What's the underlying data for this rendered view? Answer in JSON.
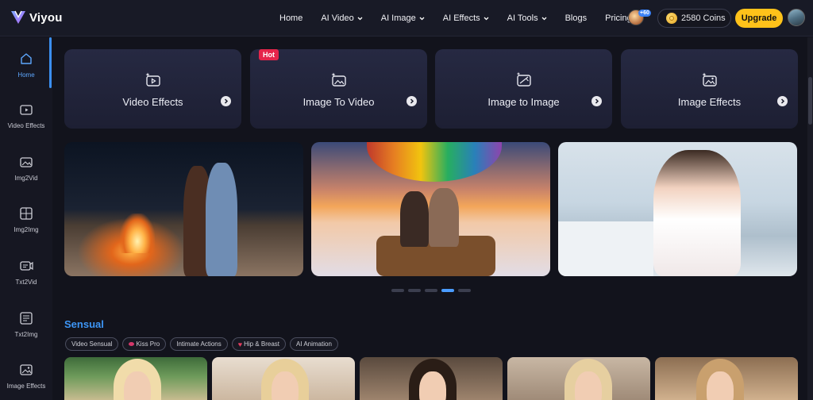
{
  "header": {
    "brand": "Viyou",
    "nav": [
      {
        "label": "Home",
        "dropdown": false
      },
      {
        "label": "AI Video",
        "dropdown": true
      },
      {
        "label": "AI Image",
        "dropdown": true
      },
      {
        "label": "AI Effects",
        "dropdown": true
      },
      {
        "label": "AI Tools",
        "dropdown": true
      },
      {
        "label": "Blogs",
        "dropdown": false
      },
      {
        "label": "Pricing",
        "dropdown": false
      }
    ],
    "bonus_badge": "+60",
    "coins": "2580 Coins",
    "upgrade_label": "Upgrade"
  },
  "sidebar": {
    "items": [
      {
        "label": "Home",
        "icon": "home-icon",
        "active": true
      },
      {
        "label": "Video Effects",
        "icon": "video-effects-icon",
        "active": false
      },
      {
        "label": "Img2Vid",
        "icon": "image-to-video-icon",
        "active": false
      },
      {
        "label": "Img2Img",
        "icon": "image-to-image-icon",
        "active": false
      },
      {
        "label": "Txt2Vid",
        "icon": "text-to-video-icon",
        "active": false
      },
      {
        "label": "Txt2Img",
        "icon": "text-to-image-icon",
        "active": false
      },
      {
        "label": "Image Effects",
        "icon": "image-effects-icon",
        "active": false
      }
    ]
  },
  "features": {
    "cards": [
      {
        "label": "Video Effects",
        "icon": "video-sparkle-icon"
      },
      {
        "label": "Image To Video",
        "icon": "image-video-icon"
      },
      {
        "label": "Image to Image",
        "icon": "image-magic-icon"
      },
      {
        "label": "Image Effects",
        "icon": "image-sparkle-icon"
      }
    ],
    "hot_badge": "Hot"
  },
  "carousel": {
    "slide_count": 5,
    "active_index": 3
  },
  "section": {
    "title": "Sensual",
    "chips": [
      {
        "label": "Video Sensual",
        "icon": null
      },
      {
        "label": "Kiss Pro",
        "icon": "lips-icon"
      },
      {
        "label": "Intimate Actions",
        "icon": null
      },
      {
        "label": "Hip & Breast",
        "icon": "heart-icon"
      },
      {
        "label": "AI Animation",
        "icon": null
      }
    ]
  },
  "colors": {
    "accent": "#3b8ff0",
    "upgrade": "#ffc21a",
    "hot": "#e5254b",
    "background": "#12131c"
  }
}
